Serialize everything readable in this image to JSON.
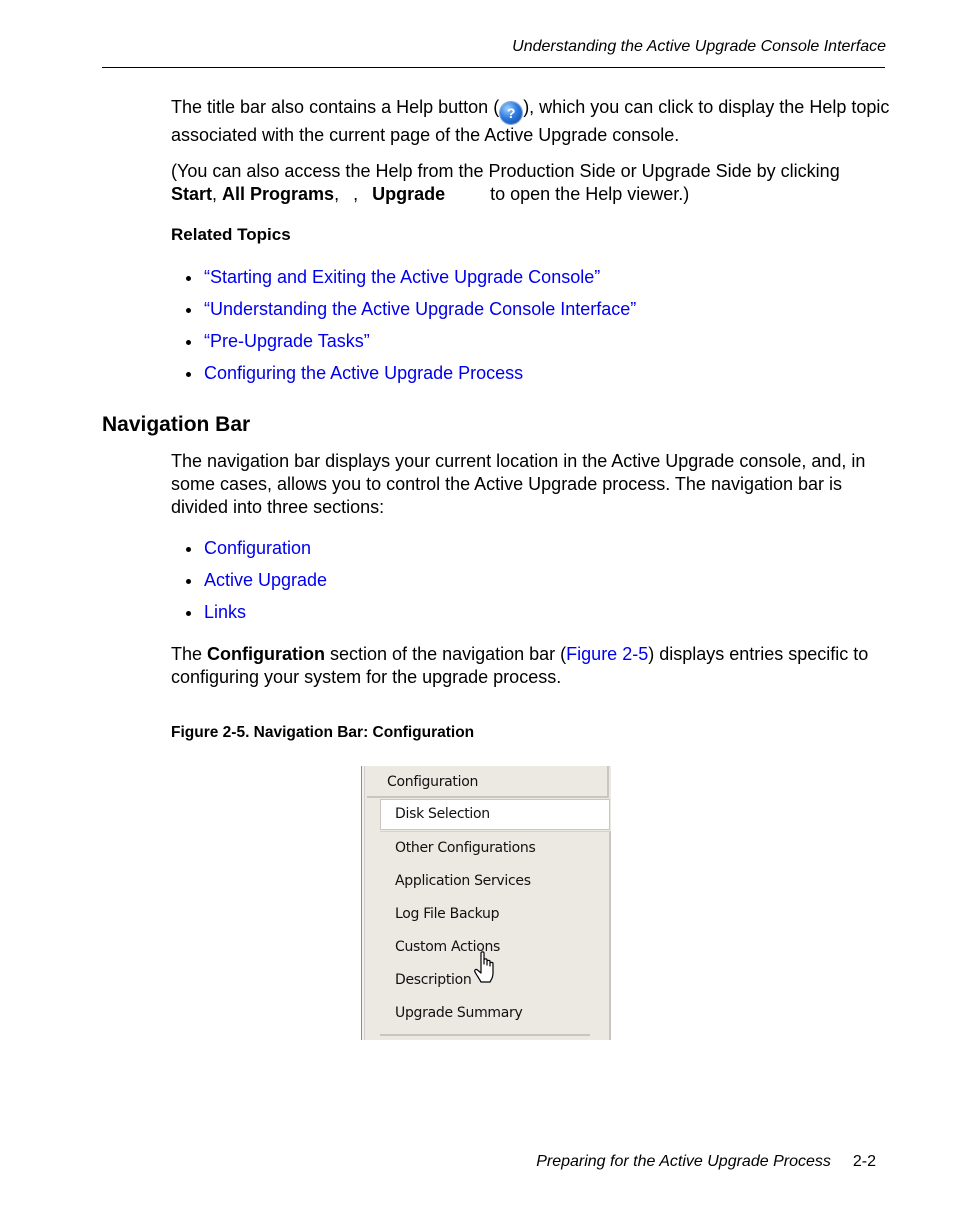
{
  "header": {
    "running_title": "Understanding the Active Upgrade Console Interface"
  },
  "paragraph1": {
    "before_icon": "The title bar also contains a Help button (",
    "icon": "help-icon",
    "after_icon": "), which you can click to display the Help topic associated with the current page of the Active Upgrade console."
  },
  "paragraph2": {
    "line1": "(You can also access the Help from the Production Side or Upgrade Side by clicking",
    "start": "Start",
    "comma1": ", ",
    "all_programs": "All Programs",
    "comma2": ",",
    "comma3": ",",
    "upgrade": "Upgrade",
    "tail": "to open the Help viewer.)"
  },
  "related_topics": {
    "heading": "Related Topics",
    "links": [
      "“Starting and Exiting the Active Upgrade Console”",
      "“Understanding the Active Upgrade Console Interface”",
      "“Pre-Upgrade Tasks”",
      "Configuring the Active Upgrade Process"
    ]
  },
  "navigation_bar": {
    "heading": "Navigation Bar",
    "intro": "The navigation bar displays your current location in the Active Upgrade console, and, in some cases, allows you to control the Active Upgrade process. The navigation bar is divided into three sections:",
    "sections": [
      "Configuration",
      "Active Upgrade",
      "Links"
    ],
    "config_para": {
      "the": "The ",
      "bold": "Configuration",
      "mid": " section of the navigation bar (",
      "fig_link": "Figure 2-5",
      "end": ") displays entries specific to configuring your system for the upgrade process."
    }
  },
  "figure": {
    "caption": "Figure 2-5. Navigation Bar: Configuration",
    "panel": {
      "header": "Configuration",
      "selected_item": "Disk Selection",
      "items": [
        "Other Configurations",
        "Application Services",
        "Log File Backup",
        "Custom Actions",
        "Description",
        "Upgrade Summary"
      ],
      "cursor": "hand-pointer-icon"
    }
  },
  "footer": {
    "chapter_title": "Preparing for the Active Upgrade Process",
    "page_number": "2-2"
  },
  "colors": {
    "link": "#0000ee",
    "panel_bg": "#ece9e3"
  }
}
